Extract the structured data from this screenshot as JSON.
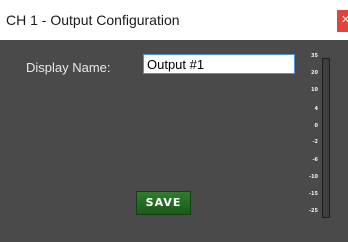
{
  "window": {
    "title": "CH 1 - Output Configuration",
    "close_icon": "close-icon"
  },
  "form": {
    "display_name_label": "Display Name:",
    "display_name_value": "Output #1",
    "save_label": "SAVE"
  },
  "meter": {
    "ticks": [
      "35",
      "20",
      "10",
      "4",
      "0",
      "-2",
      "-6",
      "-10",
      "-15",
      "-25"
    ]
  },
  "colors": {
    "panel_bg": "#4a4a4a",
    "save_button": "#2e7d2e",
    "close_button": "#e0443a",
    "input_border": "#4a90d9"
  }
}
